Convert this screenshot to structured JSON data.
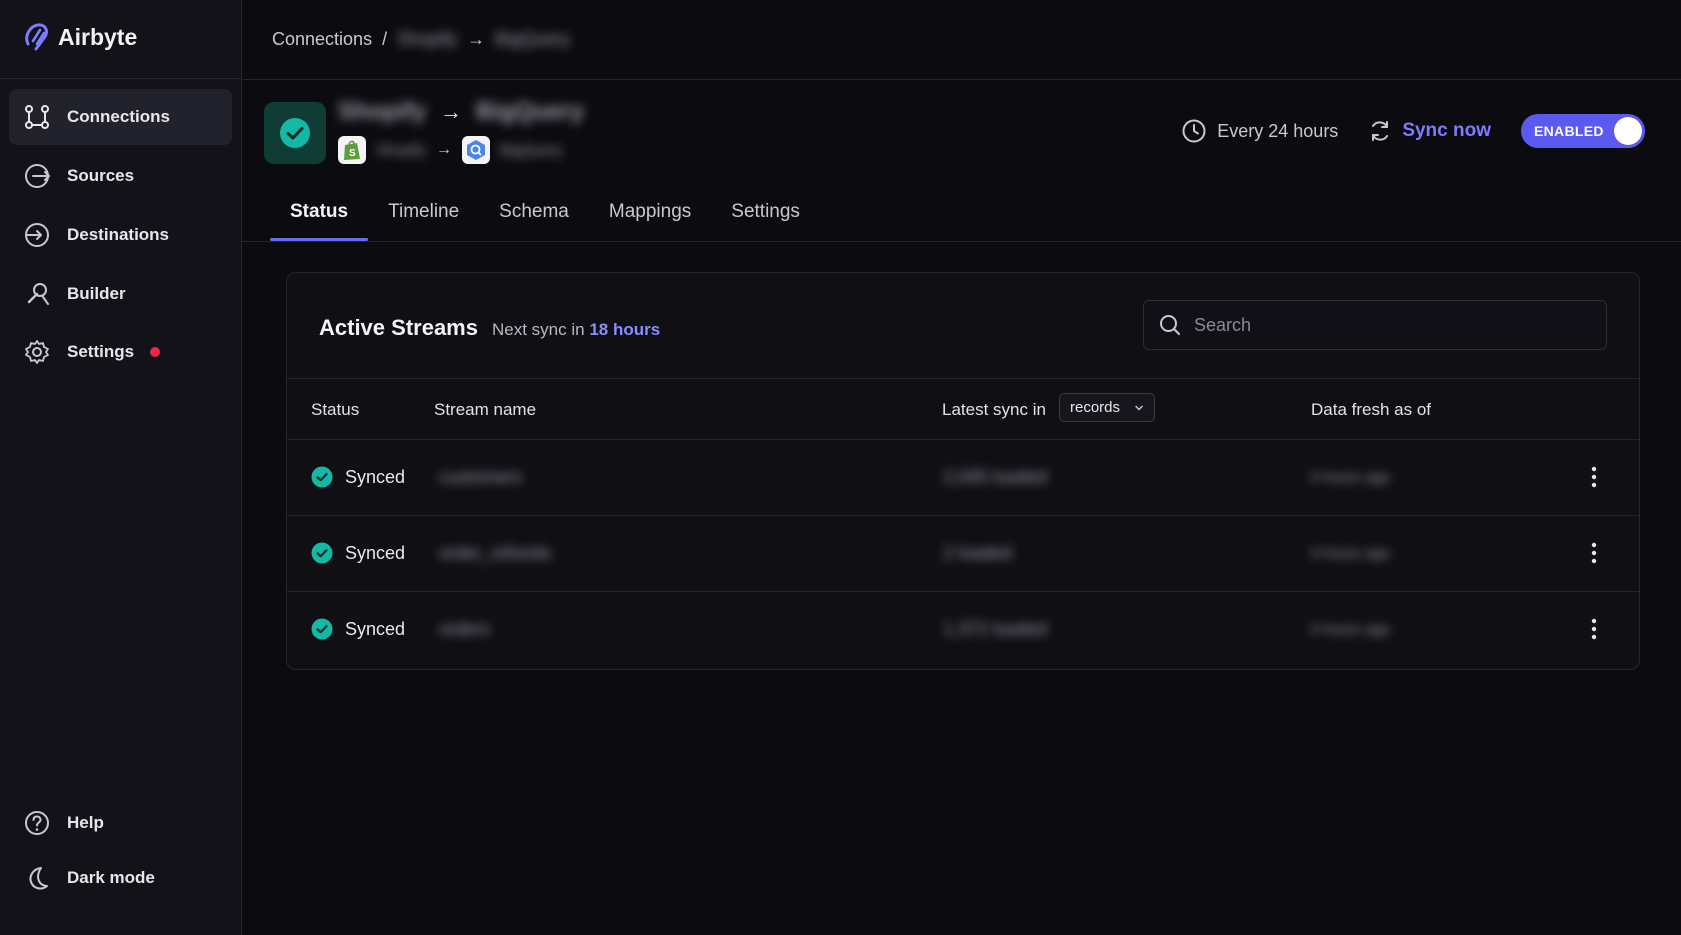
{
  "app": {
    "name": "Airbyte"
  },
  "sidebar": {
    "items": [
      {
        "label": "Connections",
        "icon": "connections-icon",
        "active": true
      },
      {
        "label": "Sources",
        "icon": "sources-icon"
      },
      {
        "label": "Destinations",
        "icon": "destinations-icon"
      },
      {
        "label": "Builder",
        "icon": "builder-icon"
      },
      {
        "label": "Settings",
        "icon": "gear-icon",
        "notification": true
      }
    ],
    "bottom": [
      {
        "label": "Help",
        "icon": "help-icon"
      },
      {
        "label": "Dark mode",
        "icon": "moon-icon"
      }
    ]
  },
  "breadcrumb": {
    "root": "Connections",
    "separator": "/",
    "source": "Shopify",
    "destination": "BigQuery"
  },
  "connection": {
    "source_name": "Shopify",
    "destination_name": "BigQuery",
    "source_connector": "Shopify",
    "destination_connector": "BigQuery",
    "schedule": "Every 24 hours",
    "sync_now_label": "Sync now",
    "enabled_label": "ENABLED"
  },
  "tabs": [
    "Status",
    "Timeline",
    "Schema",
    "Mappings",
    "Settings"
  ],
  "streams_card": {
    "title": "Active Streams",
    "next_sync_prefix": "Next sync in",
    "next_sync_value": "18 hours",
    "search_placeholder": "Search",
    "columns": {
      "status": "Status",
      "stream_name": "Stream name",
      "latest_sync": "Latest sync in",
      "latest_sync_unit": "records",
      "data_fresh": "Data fresh as of"
    },
    "rows": [
      {
        "status": "Synced",
        "name": "customers",
        "latest": "2,045 loaded",
        "fresh": "6 hours ago"
      },
      {
        "status": "Synced",
        "name": "order_refunds",
        "latest": "2 loaded",
        "fresh": "6 hours ago"
      },
      {
        "status": "Synced",
        "name": "orders",
        "latest": "1,372 loaded",
        "fresh": "6 hours ago"
      }
    ]
  },
  "colors": {
    "accent": "#6a6af4",
    "success": "#14b8a6",
    "notification": "#f0254a",
    "background": "#0c0c10"
  }
}
